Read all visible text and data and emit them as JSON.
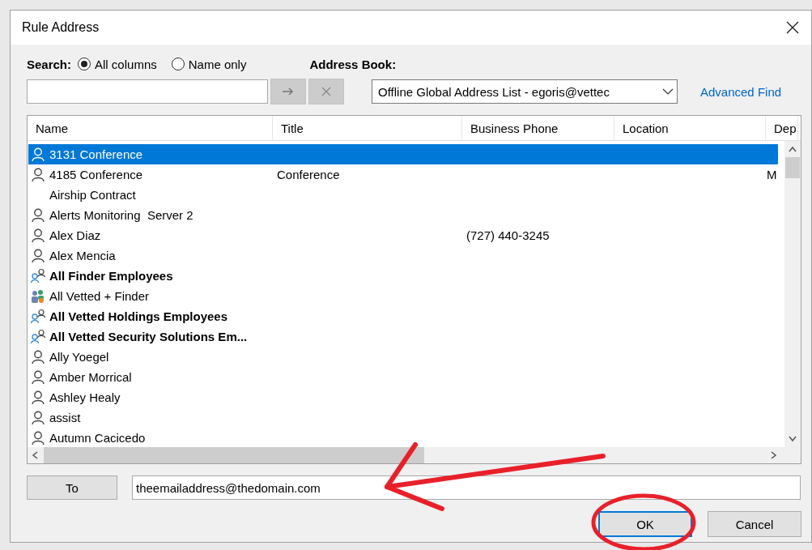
{
  "window": {
    "title": "Rule Address"
  },
  "search": {
    "label": "Search:",
    "options": [
      {
        "label": "All columns",
        "selected": true
      },
      {
        "label": "Name only",
        "selected": false
      }
    ]
  },
  "address_book": {
    "label": "Address Book:",
    "value": "Offline Global Address List - egoris@vettec"
  },
  "advanced_find": "Advanced Find",
  "table": {
    "columns": [
      "Name",
      "Title",
      "Business Phone",
      "Location",
      "Dep"
    ],
    "rows": [
      {
        "kind": "person",
        "name": "3131 Conference",
        "selected": true
      },
      {
        "kind": "person",
        "name": "4185 Conference",
        "title": "Conference",
        "column_5": "M",
        "selected": false
      },
      {
        "kind": "none",
        "name": "Airship Contract",
        "selected": false
      },
      {
        "kind": "person",
        "name": "Alerts Monitoring  Server 2",
        "selected": false
      },
      {
        "kind": "person",
        "name": "Alex Diaz",
        "phone": "(727) 440-3245",
        "selected": false
      },
      {
        "kind": "person",
        "name": "Alex Mencia",
        "selected": false
      },
      {
        "kind": "group",
        "name": "All Finder Employees",
        "selected": false
      },
      {
        "kind": "team",
        "name": "All Vetted + Finder",
        "selected": false
      },
      {
        "kind": "group",
        "name": "All Vetted Holdings Employees",
        "selected": false
      },
      {
        "kind": "group",
        "name": "All Vetted Security Solutions Em...",
        "selected": false
      },
      {
        "kind": "person",
        "name": "Ally Yoegel",
        "selected": false
      },
      {
        "kind": "person",
        "name": "Amber Morrical",
        "selected": false
      },
      {
        "kind": "person",
        "name": "Ashley Healy",
        "selected": false
      },
      {
        "kind": "person",
        "name": "assist",
        "selected": false
      },
      {
        "kind": "person",
        "name": "Autumn Cacicedo",
        "selected": false
      }
    ]
  },
  "to": {
    "button": "To",
    "value": "theemailaddress@thedomain.com"
  },
  "buttons": [
    {
      "label": "OK",
      "default": true
    },
    {
      "label": "Cancel",
      "default": false
    }
  ]
}
